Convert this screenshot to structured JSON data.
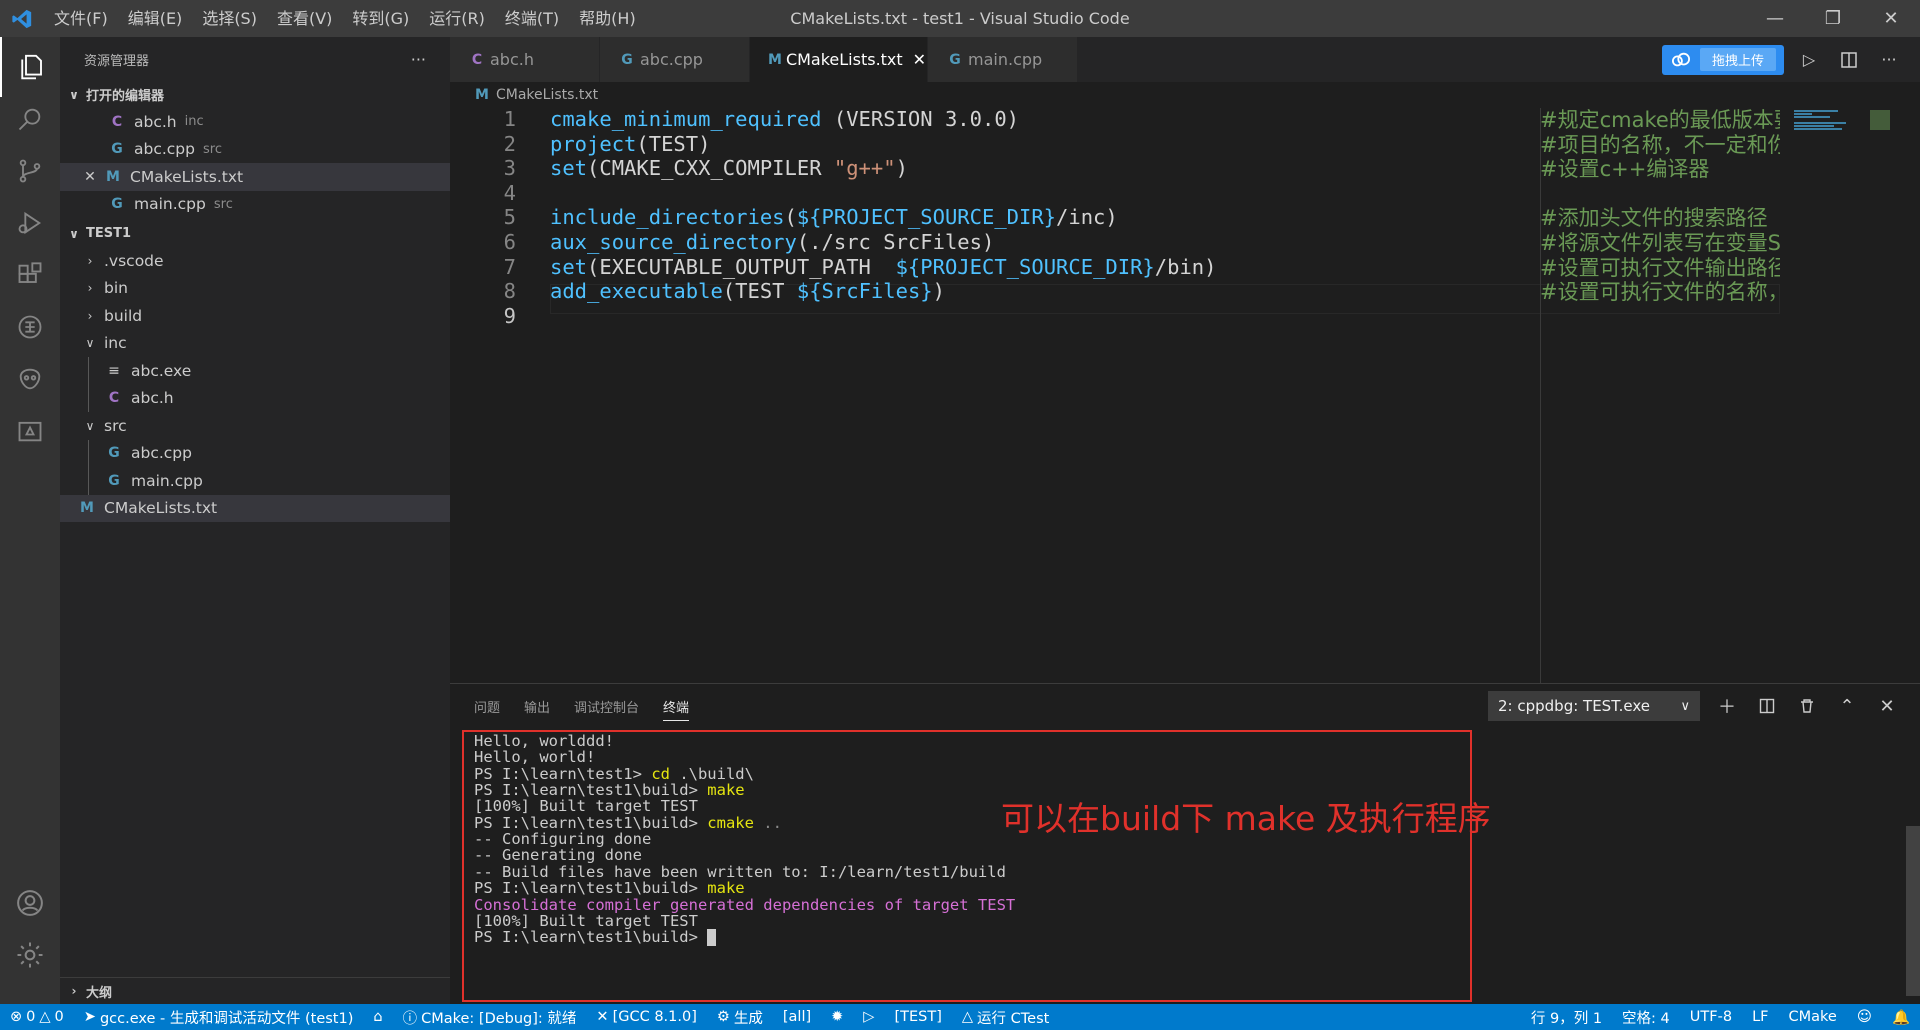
{
  "window": {
    "title": "CMakeLists.txt - test1 - Visual Studio Code",
    "menu": [
      "文件(F)",
      "编辑(E)",
      "选择(S)",
      "查看(V)",
      "转到(G)",
      "运行(R)",
      "终端(T)",
      "帮助(H)"
    ]
  },
  "sidebar": {
    "title": "资源管理器",
    "more": "···",
    "open_editors": {
      "title": "打开的编辑器",
      "items": [
        {
          "icon": "C",
          "name": "abc.h",
          "desc": "inc"
        },
        {
          "icon": "G",
          "name": "abc.cpp",
          "desc": "src"
        },
        {
          "icon": "M",
          "name": "CMakeLists.txt",
          "desc": ""
        },
        {
          "icon": "G",
          "name": "main.cpp",
          "desc": "src"
        }
      ]
    },
    "workspace": {
      "title": "TEST1",
      "items": [
        ".vscode",
        "bin",
        "build",
        "inc",
        "abc.exe",
        "abc.h",
        "src",
        "abc.cpp",
        "main.cpp",
        "CMakeLists.txt"
      ]
    },
    "outline": "大纲"
  },
  "tabs": [
    {
      "icon": "C",
      "label": "abc.h"
    },
    {
      "icon": "G",
      "label": "abc.cpp"
    },
    {
      "icon": "M",
      "label": "CMakeLists.txt",
      "close": "✕"
    },
    {
      "icon": "G",
      "label": "main.cpp"
    }
  ],
  "cloud_upload": "拖拽上传",
  "breadcrumb": {
    "icon": "M",
    "label": "CMakeLists.txt"
  },
  "editor": {
    "line_numbers": [
      "1",
      "2",
      "3",
      "4",
      "5",
      "6",
      "7",
      "8",
      "9"
    ],
    "lines": [
      {
        "parts": [
          [
            "fn",
            "cmake_minimum_required"
          ],
          [
            "pl",
            " (VERSION 3.0.0)"
          ]
        ],
        "comment": "#规定cmake的最低版本要求"
      },
      {
        "parts": [
          [
            "fn",
            "project"
          ],
          [
            "pl",
            "(TEST)"
          ]
        ],
        "comment": "#项目的名称，不一定和你的文件夹名称一样"
      },
      {
        "parts": [
          [
            "fn",
            "set"
          ],
          [
            "pl",
            "(CMAKE_CXX_COMPILER "
          ],
          [
            "str",
            "\"g++\""
          ],
          [
            "pl",
            ")"
          ]
        ],
        "comment": "#设置c++编译器"
      },
      {
        "parts": [],
        "comment": ""
      },
      {
        "parts": [
          [
            "fn",
            "include_directories"
          ],
          [
            "pl",
            "("
          ],
          [
            "var",
            "${PROJECT_SOURCE_DIR}"
          ],
          [
            "pl",
            "/inc)"
          ]
        ],
        "comment": "#添加头文件的搜索路径"
      },
      {
        "parts": [
          [
            "fn",
            "aux_source_directory"
          ],
          [
            "pl",
            "(./src SrcFiles)"
          ]
        ],
        "comment": "#将源文件列表写在变量SrcFiles中"
      },
      {
        "parts": [
          [
            "fn",
            "set"
          ],
          [
            "pl",
            "(EXECUTABLE_OUTPUT_PATH  "
          ],
          [
            "var",
            "${PROJECT_SOURCE_DIR}"
          ],
          [
            "pl",
            "/bin)"
          ]
        ],
        "comment": "#设置可执行文件输出路径"
      },
      {
        "parts": [
          [
            "fn",
            "add_executable"
          ],
          [
            "pl",
            "(TEST "
          ],
          [
            "var",
            "${SrcFiles}"
          ],
          [
            "pl",
            ")"
          ]
        ],
        "comment": "#设置可执行文件的名称，make之后bin目录下出现TEST.exe"
      },
      {
        "parts": [],
        "comment": ""
      }
    ]
  },
  "panel": {
    "tabs": [
      "问题",
      "输出",
      "调试控制台",
      "终端"
    ],
    "terminal_select": "2: cppdbg: TEST.exe",
    "terminal": [
      [
        [
          "pl",
          "Hello, worlddd!"
        ]
      ],
      [
        [
          "pl",
          "Hello, world!"
        ]
      ],
      [
        [
          "pl",
          "PS I:\\learn\\test1> "
        ],
        [
          "cmd",
          "cd"
        ],
        [
          "pl",
          " .\\build\\"
        ]
      ],
      [
        [
          "pl",
          "PS I:\\learn\\test1\\build> "
        ],
        [
          "cmd",
          "make"
        ]
      ],
      [
        [
          "pl",
          "[100%] Built target TEST"
        ]
      ],
      [
        [
          "pl",
          "PS I:\\learn\\test1\\build> "
        ],
        [
          "cmd",
          "cmake"
        ],
        [
          "dim",
          " .."
        ]
      ],
      [
        [
          "pl",
          "-- Configuring done"
        ]
      ],
      [
        [
          "pl",
          "-- Generating done"
        ]
      ],
      [
        [
          "pl",
          "-- Build files have been written to: I:/learn/test1/build"
        ]
      ],
      [
        [
          "pl",
          "PS I:\\learn\\test1\\build> "
        ],
        [
          "cmd",
          "make"
        ]
      ],
      [
        [
          "mag",
          "Consolidate compiler generated dependencies of target TEST"
        ]
      ],
      [
        [
          "pl",
          "[100%] Built target TEST"
        ]
      ],
      [
        [
          "pl",
          "PS I:\\learn\\test1\\build> "
        ],
        [
          "cursor",
          ""
        ]
      ]
    ],
    "annotation": "可以在build下 make 及执行程序"
  },
  "statusbar": {
    "errors": "0",
    "warnings": "0",
    "task": "gcc.exe - 生成和调试活动文件 (test1)",
    "cmake_status": "CMake: [Debug]: 就绪",
    "kit": "[GCC 8.1.0]",
    "build": "生成",
    "target_all": "[all]",
    "target_test": "[TEST]",
    "ctest": "运行 CTest",
    "position": "行 9，列 1",
    "spaces": "空格: 4",
    "encoding": "UTF-8",
    "eol": "LF",
    "language": "CMake"
  }
}
